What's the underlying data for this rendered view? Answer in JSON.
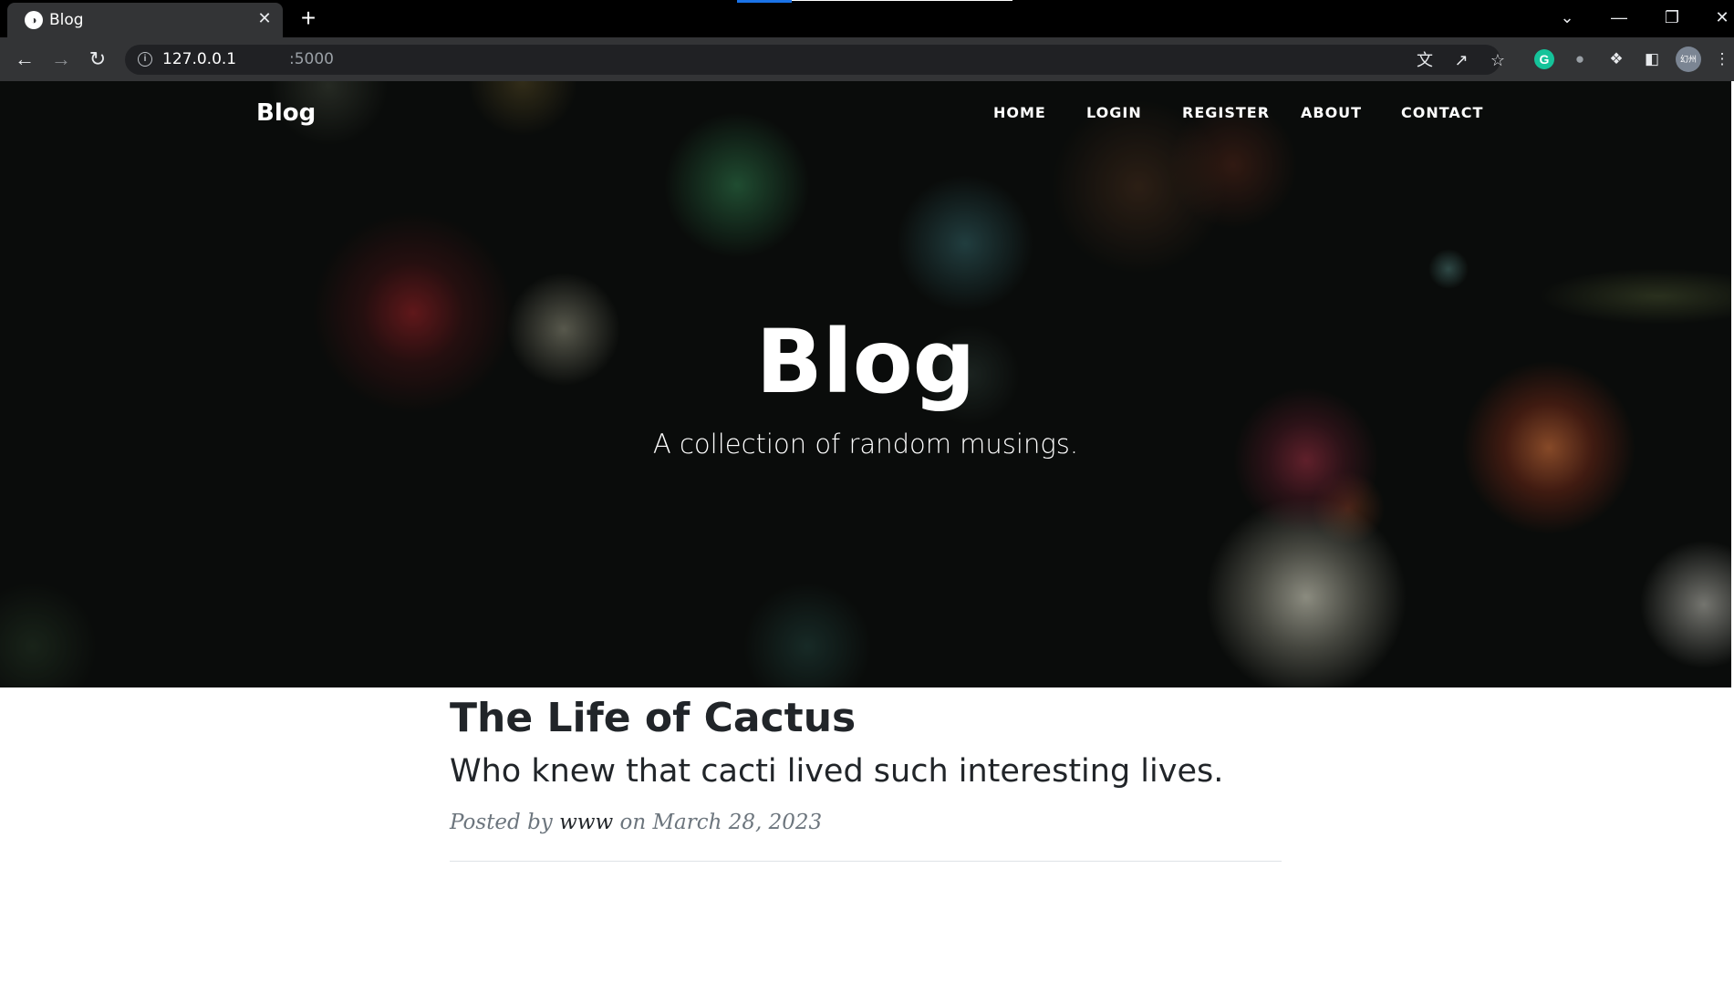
{
  "browser": {
    "tab_title": "Blog",
    "url_host": "127.0.0.1",
    "url_port": ":5000",
    "profile_label": "幻州",
    "grammarly_label": "G",
    "icons": {
      "favicon": "globe-icon",
      "tab_close": "close-icon",
      "new_tab": "plus-icon",
      "back": "arrow-left-icon",
      "forward": "arrow-right-icon",
      "reload": "reload-icon",
      "site_info": "info-icon",
      "translate": "translate-icon",
      "share": "share-icon",
      "bookmark": "star-icon",
      "extensions": "puzzle-icon",
      "side_panel": "side-panel-icon",
      "menu": "kebab-menu-icon"
    },
    "colors": {
      "tabstrip": "#000000",
      "toolbar": "#333436",
      "omnibox": "#202124",
      "loadbar": "#1a73e8"
    }
  },
  "site": {
    "brand": "Blog",
    "nav": [
      "HOME",
      "LOGIN",
      "REGISTER",
      "ABOUT",
      "CONTACT"
    ],
    "hero": {
      "title": "Blog",
      "subtitle": "A collection of random musings."
    }
  },
  "posts": [
    {
      "title": "The Life of Cactus",
      "subtitle": "Who knew that cacti lived such interesting lives.",
      "meta_prefix": "Posted by",
      "author": "www",
      "meta_mid": "on",
      "date": "March 28, 2023"
    }
  ]
}
